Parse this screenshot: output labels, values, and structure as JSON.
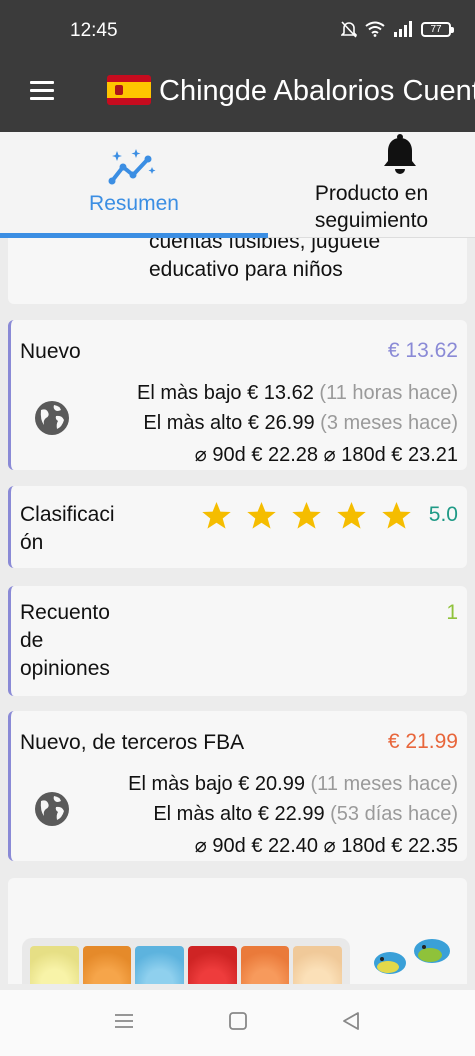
{
  "status_bar": {
    "time": "12:45",
    "battery": "77"
  },
  "app_bar": {
    "title": "Chingde Abalorios Cuentas fusibles"
  },
  "tabs": [
    {
      "label": "Resumen"
    },
    {
      "label_line1": "Producto en",
      "label_line2": "seguimiento"
    }
  ],
  "product": {
    "title_line1": "cuentas fusibles, juguete",
    "title_line2": "educativo para niños"
  },
  "nuevo": {
    "label": "Nuevo",
    "price": "€ 13.62",
    "low_label": "El màs bajo",
    "low_price": "€ 13.62",
    "low_when": "(11 horas hace)",
    "high_label": "El màs alto",
    "high_price": "€ 26.99",
    "high_when": "(3 meses hace)",
    "avg90_label": "⌀ 90d",
    "avg90": "€ 22.28",
    "avg180_label": "⌀ 180d",
    "avg180": "€ 23.21"
  },
  "rating": {
    "label_line1": "Clasificaci",
    "label_line2": "ón",
    "stars": 5,
    "value": "5.0"
  },
  "reviews": {
    "label_line1": "Recuento",
    "label_line2": "de",
    "label_line3": "opiniones",
    "value": "1"
  },
  "fba": {
    "label": "Nuevo, de terceros FBA",
    "price": "€ 21.99",
    "low_label": "El màs bajo",
    "low_price": "€ 20.99",
    "low_when": "(11 meses hace)",
    "high_label": "El màs alto",
    "high_price": "€ 22.99",
    "high_when": "(53 días hace)",
    "avg90_label": "⌀ 90d",
    "avg90": "€ 22.40",
    "avg180_label": "⌀ 180d",
    "avg180": "€ 22.35"
  },
  "colors": {
    "accent_blue": "#3b8ee3",
    "nuevo": "#8a8ad6",
    "rating": "#1f9a86",
    "reviews": "#8fc23a",
    "fba": "#e8663b",
    "star": "#f5bd00"
  }
}
